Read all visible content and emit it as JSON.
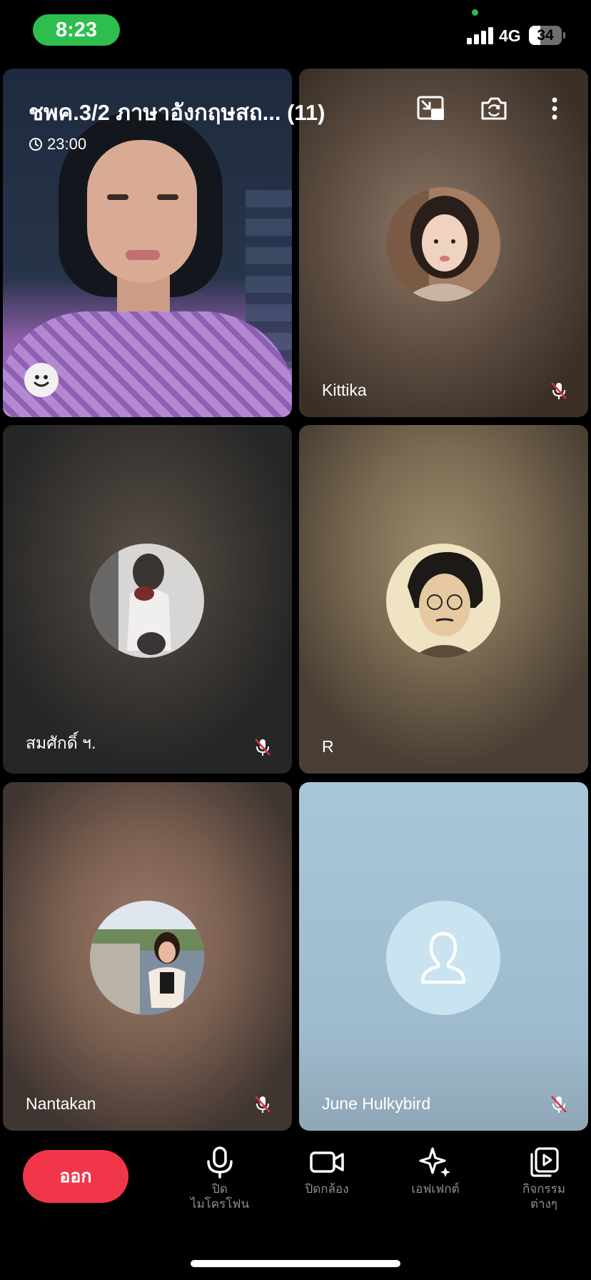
{
  "status_bar": {
    "time": "8:23",
    "network": "4G",
    "battery_percent": "34",
    "battery_level": 0.34,
    "signal_bars": 4,
    "accent_color": "#2dbe4e"
  },
  "call": {
    "title": "ชพค.3/2 ภาษาอังกฤษสถ... (11)",
    "timer": "23:00",
    "header_icons": [
      "exit-pip-icon",
      "switch-camera-icon",
      "more-vertical-icon"
    ]
  },
  "participants": [
    {
      "name": "",
      "role": "self-video",
      "icon": "smiley-icon"
    },
    {
      "name": "Kittika",
      "muted": true
    },
    {
      "name": "สมศักดิ์ ฯ.",
      "muted": true
    },
    {
      "name": "R",
      "muted": false
    },
    {
      "name": "Nantakan",
      "muted": true
    },
    {
      "name": "June Hulkybird",
      "muted": true,
      "avatar": "default-person-icon"
    }
  ],
  "controls": {
    "leave": "ออก",
    "mic_line1": "ปิด",
    "mic_line2": "ไมโครโฟน",
    "camera": "ปิดกล้อง",
    "effects": "เอฟเฟกต์",
    "activities_line1": "กิจกรรม",
    "activities_line2": "ต่างๆ"
  },
  "colors": {
    "leave_button": "#f2364a",
    "muted_mic": "#e02a3a",
    "control_label": "#8e8e8e"
  }
}
